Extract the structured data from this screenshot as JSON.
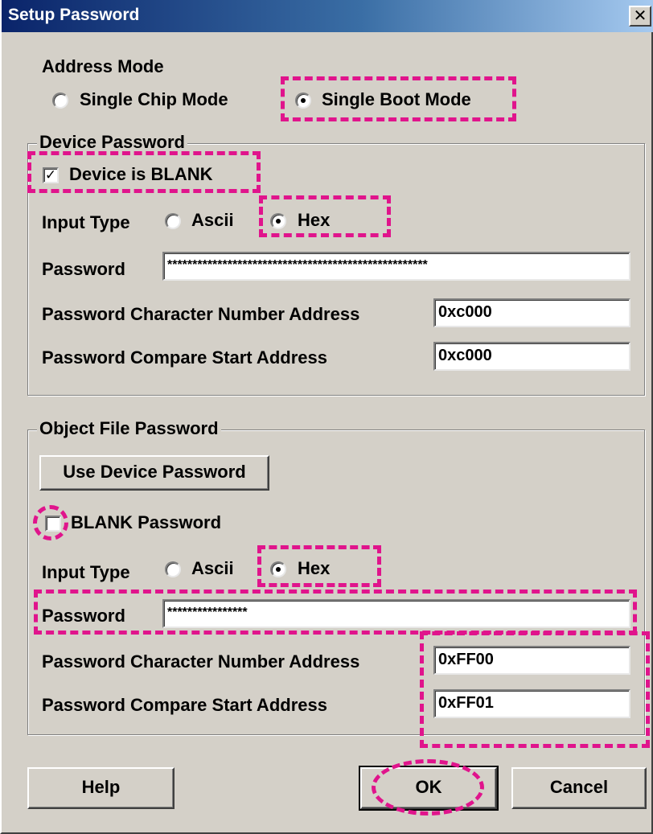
{
  "window": {
    "title": "Setup Password",
    "close_glyph": "✕"
  },
  "address_mode": {
    "label": "Address Mode",
    "options": [
      {
        "label": "Single Chip Mode",
        "selected": false
      },
      {
        "label": "Single Boot Mode",
        "selected": true
      }
    ]
  },
  "device_password": {
    "group_label": "Device Password",
    "blank_checkbox": {
      "label": "Device is BLANK",
      "checked": true,
      "check_glyph": "✓"
    },
    "input_type": {
      "label": "Input Type",
      "options": [
        {
          "label": "Ascii",
          "selected": false
        },
        {
          "label": "Hex",
          "selected": true
        }
      ]
    },
    "password_label": "Password",
    "password_value": "****************************************************",
    "char_number_address_label": "Password Character Number Address",
    "char_number_address_value": "0xc000",
    "compare_start_address_label": "Password Compare Start Address",
    "compare_start_address_value": "0xc000"
  },
  "object_file_password": {
    "group_label": "Object File Password",
    "use_device_password_button": "Use Device Password",
    "blank_checkbox": {
      "label": "BLANK Password",
      "checked": false
    },
    "input_type": {
      "label": "Input Type",
      "options": [
        {
          "label": "Ascii",
          "selected": false
        },
        {
          "label": "Hex",
          "selected": true
        }
      ]
    },
    "password_label": "Password",
    "password_value": "****************",
    "char_number_address_label": "Password Character Number Address",
    "char_number_address_value": "0xFF00",
    "compare_start_address_label": "Password Compare Start Address",
    "compare_start_address_value": "0xFF01"
  },
  "buttons": {
    "help": "Help",
    "ok": "OK",
    "cancel": "Cancel"
  },
  "colors": {
    "highlight": "#e0148c",
    "dialog_bg": "#d4d0c8",
    "titlebar": "#0a246a"
  }
}
